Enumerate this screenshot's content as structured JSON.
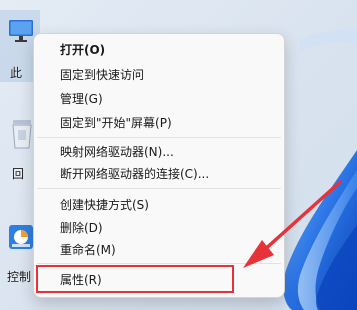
{
  "desktop": {
    "icons": [
      {
        "label": "此",
        "icon": "monitor-icon"
      },
      {
        "label": "回",
        "icon": "recycle-bin-icon"
      },
      {
        "label": "控制",
        "icon": "control-panel-icon"
      }
    ]
  },
  "context_menu": {
    "items": [
      {
        "label": "打开(O)"
      },
      {
        "label": "固定到快速访问"
      },
      {
        "label": "管理(G)"
      },
      {
        "label": "固定到\"开始\"屏幕(P)"
      },
      {
        "label": "映射网络驱动器(N)..."
      },
      {
        "label": "断开网络驱动器的连接(C)..."
      },
      {
        "label": "创建快捷方式(S)"
      },
      {
        "label": "删除(D)"
      },
      {
        "label": "重命名(M)"
      },
      {
        "label": "属性(R)"
      }
    ]
  },
  "annotation": {
    "highlight_color": "#e8323a",
    "target": "属性(R)"
  },
  "colors": {
    "wallpaper_blue": "#1e6ee6",
    "menu_bg": "#f9f9f9"
  }
}
